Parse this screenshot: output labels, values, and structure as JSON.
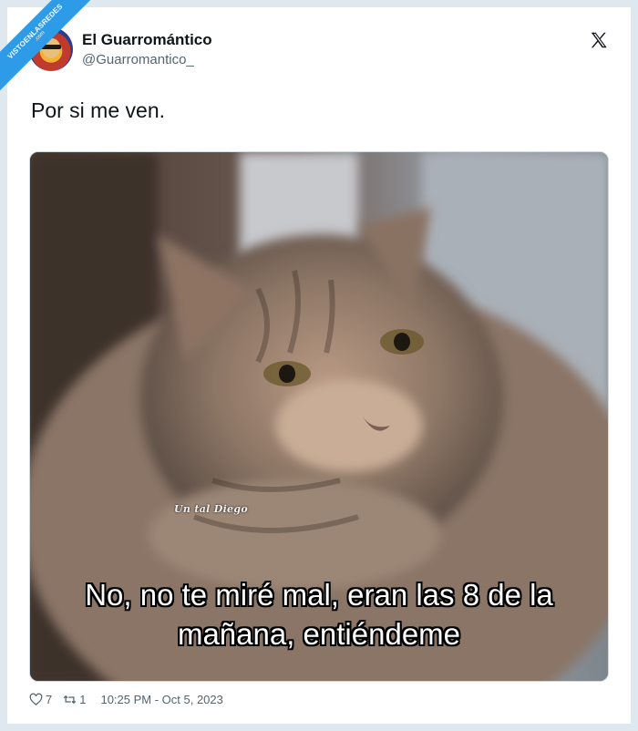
{
  "watermark": {
    "main": "VISTOENLASREDES",
    "sub": ".com"
  },
  "tweet": {
    "display_name": "El Guarromántico",
    "handle": "@Guarromantico_",
    "text": "Por si me ven.",
    "image": {
      "subject": "close-up photo of a tabby cat",
      "signature": "Un tal Diego",
      "caption": "No, no te miré mal, eran las 8 de la mañana, entiéndeme"
    },
    "likes": "7",
    "retweets": "1",
    "timestamp": "10:25 PM - Oct 5, 2023"
  },
  "icons": {
    "platform_logo": "x-logo-icon",
    "like": "heart-icon",
    "retweet": "retweet-icon"
  },
  "colors": {
    "text": "#0f1419",
    "secondary": "#536471",
    "frame": "#dfe7ef",
    "watermark": "#2d9be8"
  }
}
